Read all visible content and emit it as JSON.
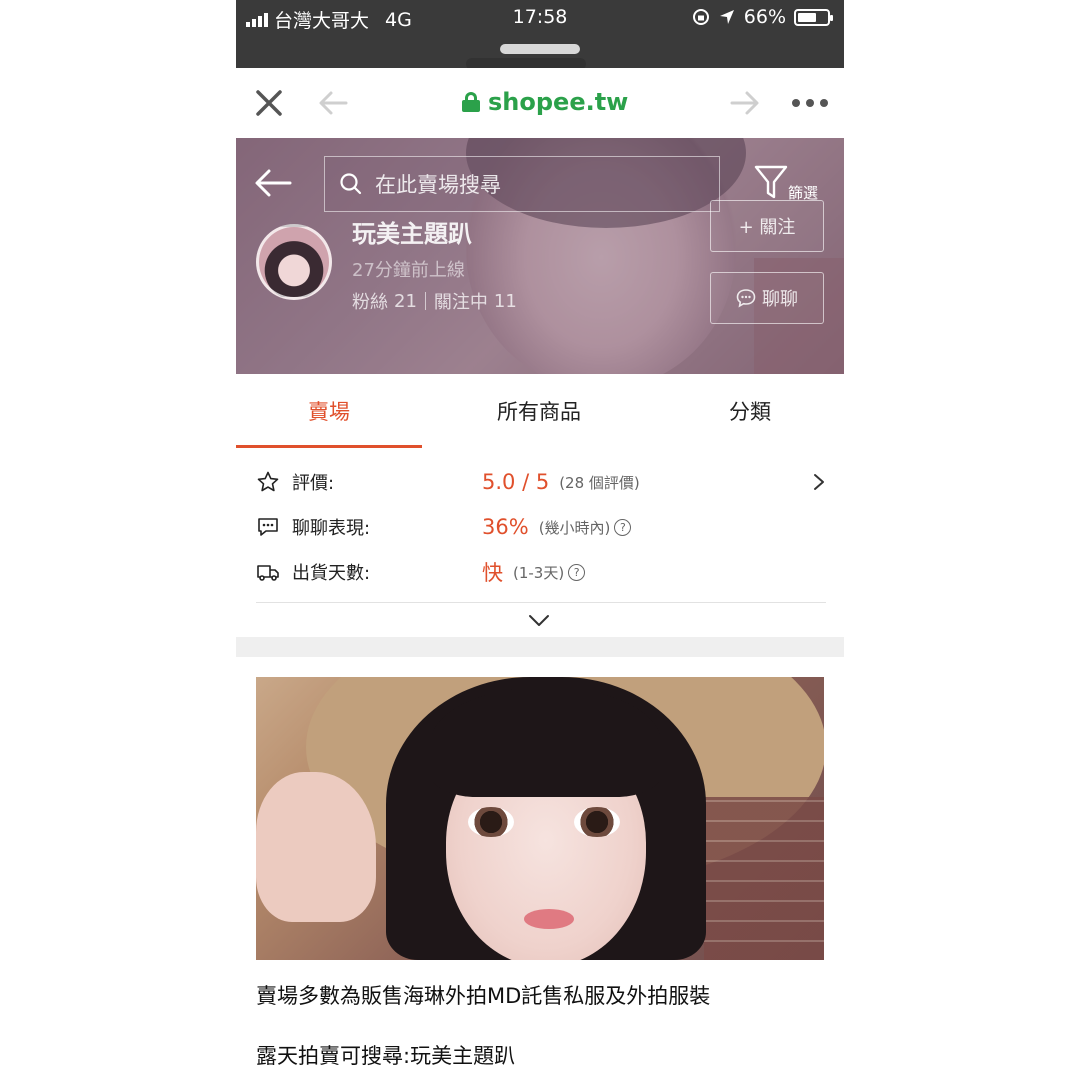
{
  "status_bar": {
    "carrier": "台灣大哥大",
    "network": "4G",
    "time": "17:58",
    "battery": "66%",
    "battery_level": 0.66
  },
  "browser": {
    "url": "shopee.tw"
  },
  "shop": {
    "search_placeholder": "在此賣場搜尋",
    "filter_label": "篩選",
    "name": "玩美主題趴",
    "last_online": "27分鐘前上線",
    "followers_label": "粉絲",
    "followers": "21",
    "following_label": "關注中",
    "following": "11",
    "follow_button": "+ 關注",
    "chat_button": "聊聊"
  },
  "tabs": [
    {
      "label": "賣場",
      "active": true
    },
    {
      "label": "所有商品",
      "active": false
    },
    {
      "label": "分類",
      "active": false
    }
  ],
  "metrics": {
    "rating_label": "評價:",
    "rating_value": "5.0 / 5",
    "rating_sub": "(28 個評價)",
    "chat_label": "聊聊表現:",
    "chat_value": "36%",
    "chat_sub": "(幾小時內)",
    "shipping_label": "出貨天數:",
    "shipping_value": "快",
    "shipping_sub": "(1-3天)"
  },
  "content": {
    "line1": "賣場多數為販售海琳外拍MD託售私服及外拍服裝",
    "line2": "露天拍賣可搜尋:玩美主題趴"
  },
  "colors": {
    "accent": "#e0502c",
    "url_green": "#2ba14a"
  }
}
